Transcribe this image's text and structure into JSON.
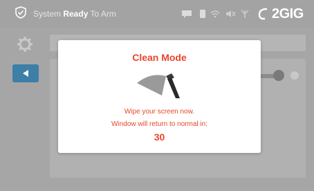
{
  "header": {
    "status_prefix": "System ",
    "status_bold": "Ready",
    "status_suffix": " To Arm",
    "brand": "2GIG",
    "icons": [
      "shield-check-icon",
      "message-icon",
      "phone-icon",
      "wifi-icon",
      "speaker-icon",
      "antenna-icon"
    ]
  },
  "modal": {
    "title": "Clean Mode",
    "icon": "wiper-icon",
    "line1": "Wipe your screen now.",
    "line2": "Window will return to normal in:",
    "countdown": "30"
  },
  "colors": {
    "accent": "#e8452a",
    "back_button": "#3d7fa6",
    "overlay": "#a6a6a6"
  }
}
